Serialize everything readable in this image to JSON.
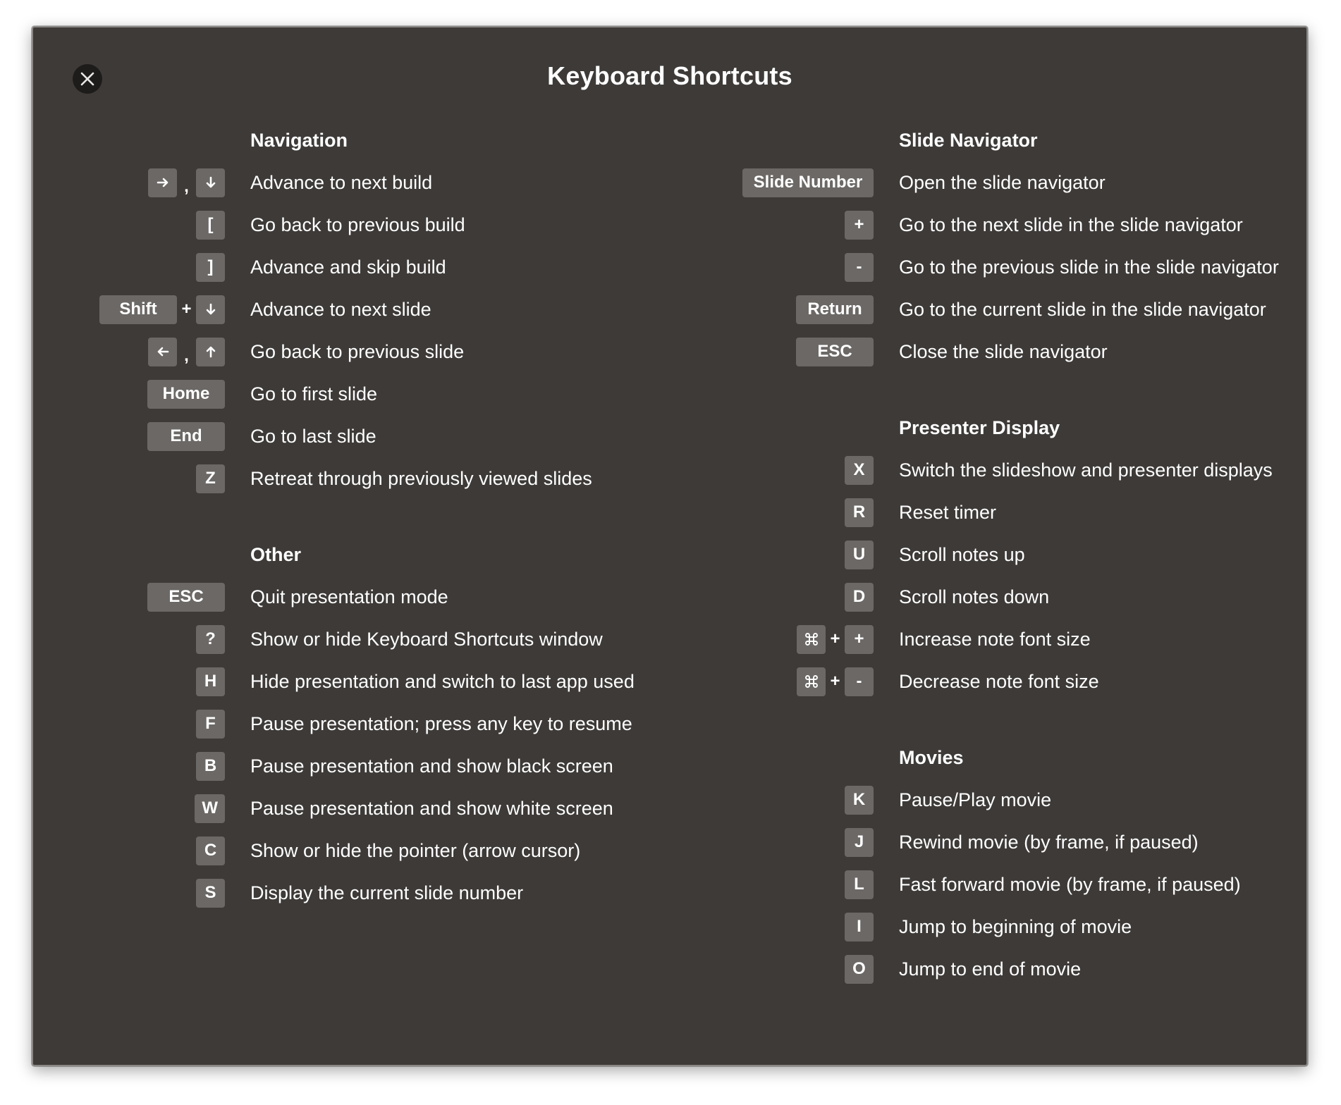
{
  "window": {
    "title": "Keyboard Shortcuts"
  },
  "icons": {
    "close": "close-icon",
    "right_arrow": "arrow-right-icon",
    "down_arrow": "arrow-down-icon",
    "left_arrow": "arrow-left-icon",
    "up_arrow": "arrow-up-icon",
    "command": "command-icon"
  },
  "colors": {
    "background": "#3d3a38",
    "key_cap": "#6b6866",
    "text": "#ffffff",
    "close_button": "#1e1c1b"
  },
  "sep": {
    "comma": ",",
    "plus": "+"
  },
  "navigation": {
    "heading": "Navigation",
    "items": [
      {
        "desc": "Advance to next build"
      },
      {
        "key": "[",
        "desc": "Go back to previous build"
      },
      {
        "key": "]",
        "desc": "Advance and skip build"
      },
      {
        "key": "Shift",
        "desc": "Advance to next slide"
      },
      {
        "desc": "Go back to previous slide"
      },
      {
        "key": "Home",
        "desc": "Go to first slide"
      },
      {
        "key": "End",
        "desc": "Go to last slide"
      },
      {
        "key": "Z",
        "desc": "Retreat through previously viewed slides"
      }
    ]
  },
  "other": {
    "heading": "Other",
    "items": [
      {
        "key": "ESC",
        "desc": "Quit presentation mode"
      },
      {
        "key": "?",
        "desc": "Show or hide Keyboard Shortcuts window"
      },
      {
        "key": "H",
        "desc": "Hide presentation and switch to last app used"
      },
      {
        "key": "F",
        "desc": "Pause presentation; press any key to resume"
      },
      {
        "key": "B",
        "desc": "Pause presentation and show black screen"
      },
      {
        "key": "W",
        "desc": "Pause presentation and show white screen"
      },
      {
        "key": "C",
        "desc": "Show or hide the pointer (arrow cursor)"
      },
      {
        "key": "S",
        "desc": "Display the current slide number"
      }
    ]
  },
  "slide_navigator": {
    "heading": "Slide Navigator",
    "items": [
      {
        "key": "Slide Number",
        "desc": "Open the slide navigator"
      },
      {
        "key": "+",
        "desc": "Go to the next slide in the slide navigator"
      },
      {
        "key": "-",
        "desc": "Go to the previous slide in the slide navigator"
      },
      {
        "key": "Return",
        "desc": "Go to the current slide in the slide navigator"
      },
      {
        "key": "ESC",
        "desc": "Close the slide navigator"
      }
    ]
  },
  "presenter_display": {
    "heading": "Presenter Display",
    "items": [
      {
        "key": "X",
        "desc": "Switch the slideshow and presenter displays"
      },
      {
        "key": "R",
        "desc": "Reset timer"
      },
      {
        "key": "U",
        "desc": "Scroll notes up"
      },
      {
        "key": "D",
        "desc": "Scroll notes down"
      },
      {
        "key": "+",
        "desc": "Increase note font size"
      },
      {
        "key": "-",
        "desc": "Decrease note font size"
      }
    ]
  },
  "movies": {
    "heading": "Movies",
    "items": [
      {
        "key": "K",
        "desc": "Pause/Play movie"
      },
      {
        "key": "J",
        "desc": "Rewind movie (by frame, if paused)"
      },
      {
        "key": "L",
        "desc": "Fast forward movie (by frame, if paused)"
      },
      {
        "key": "I",
        "desc": "Jump to beginning of movie"
      },
      {
        "key": "O",
        "desc": "Jump to end of movie"
      }
    ]
  }
}
